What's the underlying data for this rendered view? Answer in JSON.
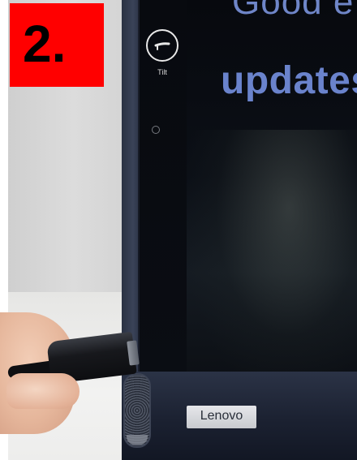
{
  "step": {
    "label": "2.",
    "background_color": "#ff0000"
  },
  "device": {
    "screen_text_top": "Good e",
    "screen_text_main": "updates",
    "sidebar_tilt_label": "Tilt",
    "brand": "Lenovo",
    "icons": [
      "tilt-icon",
      "status-ring-icon"
    ]
  },
  "scene": {
    "objects": [
      "hand",
      "usb-c-cable",
      "speaker-grille"
    ]
  }
}
